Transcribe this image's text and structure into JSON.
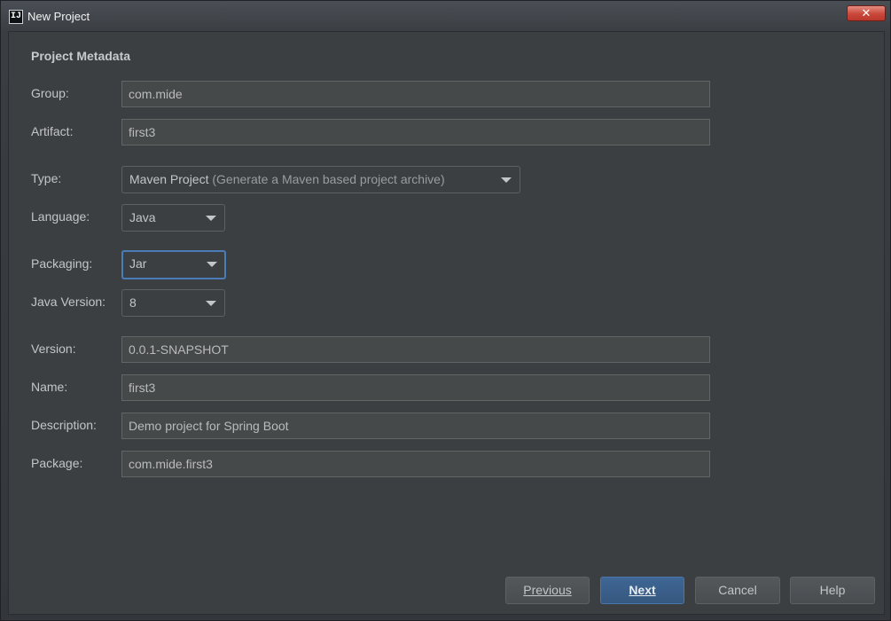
{
  "window": {
    "title": "New Project",
    "app_icon_text": "IJ",
    "close_symbol": "✕"
  },
  "section_title": "Project Metadata",
  "fields": {
    "group": {
      "label": "Group:",
      "value": "com.mide"
    },
    "artifact": {
      "label": "Artifact:",
      "value": "first3"
    },
    "type": {
      "label": "Type:",
      "value": "Maven Project",
      "hint": "(Generate a Maven based project archive)"
    },
    "language": {
      "label": "Language:",
      "value": "Java"
    },
    "packaging": {
      "label": "Packaging:",
      "value": "Jar"
    },
    "java_version": {
      "label": "Java Version:",
      "value": "8"
    },
    "version": {
      "label": "Version:",
      "value": "0.0.1-SNAPSHOT"
    },
    "name": {
      "label": "Name:",
      "value": "first3"
    },
    "description": {
      "label": "Description:",
      "value": "Demo project for Spring Boot"
    },
    "package": {
      "label": "Package:",
      "value": "com.mide.first3"
    }
  },
  "buttons": {
    "previous": "Previous",
    "next": "Next",
    "cancel": "Cancel",
    "help": "Help"
  },
  "colors": {
    "background": "#3c3f41",
    "field_background": "#45494a",
    "primary_button": "#365880",
    "focus_border": "#4a7db8",
    "close_button": "#c9483a"
  },
  "icons": {
    "app": "intellij-icon",
    "close": "close-icon",
    "dropdown": "chevron-down-icon"
  }
}
